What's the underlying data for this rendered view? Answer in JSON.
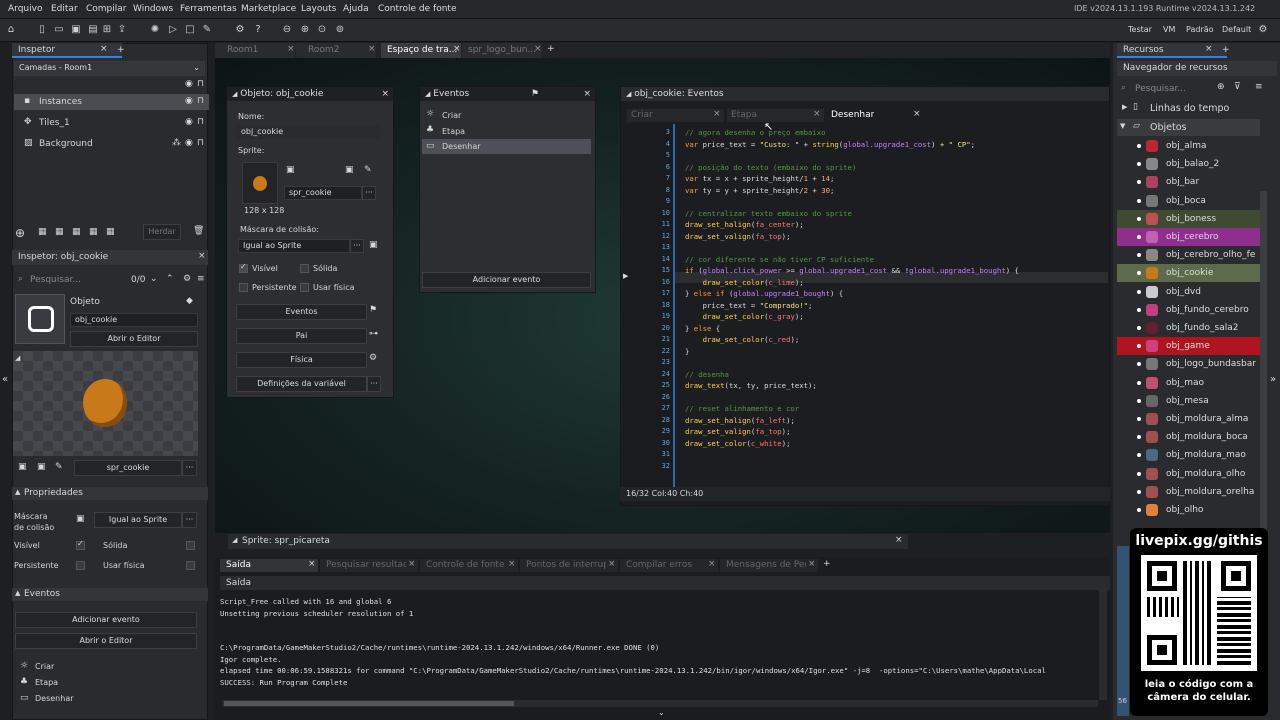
{
  "menu": [
    "Arquivo",
    "Editar",
    "Compilar",
    "Windows",
    "Ferramentas",
    "Marketplace",
    "Layouts",
    "Ajuda",
    "Controle de fonte"
  ],
  "ide_version": "IDE v2024.13.1.193  Runtime v2024.13.1.242",
  "target_bar": [
    "Testar",
    "VM",
    "Padrão",
    "Default"
  ],
  "top_tabs": [
    "Room1",
    "Room2",
    "Espaço de tra...",
    "spr_logo_bun..."
  ],
  "inspector": {
    "title": "Inspetor",
    "layers_dropdown": "Camadas - Room1",
    "layers": [
      "Instances",
      "Tiles_1",
      "Background"
    ],
    "herdar": "Herdar",
    "obj_title": "Inspetor: obj_cookie",
    "search_placeholder": "Pesquisar...",
    "count": "0/0",
    "objeto_label": "Objeto",
    "objeto_name": "obj_cookie",
    "open_editor": "Abrir o Editor",
    "sprite_name": "spr_cookie",
    "properties_header": "Propriedades",
    "mask_label": "Máscara de colisão",
    "mask_value": "Igual ao Sprite",
    "visible_label": "Visível",
    "solid_label": "Sólida",
    "persistent_label": "Persistente",
    "physics_label": "Usar física",
    "events_header": "Eventos",
    "add_event": "Adicionar evento",
    "open_editor2": "Abrir o Editor",
    "events": [
      "Criar",
      "Etapa",
      "Desenhar"
    ]
  },
  "object_window": {
    "title": "Objeto: obj_cookie",
    "name_label": "Nome:",
    "name_value": "obj_cookie",
    "sprite_label": "Sprite:",
    "sprite_value": "spr_cookie",
    "sprite_size": "128 x 128",
    "mask_label": "Máscara de colisão:",
    "mask_value": "Igual ao Sprite",
    "visible": "Visível",
    "solid": "Sólida",
    "persistent": "Persistente",
    "physics": "Usar física",
    "btn_events": "Eventos",
    "btn_parent": "Pai",
    "btn_physics": "Física",
    "btn_vars": "Definições da variável"
  },
  "events_window": {
    "title": "Eventos",
    "items": [
      "Criar",
      "Etapa",
      "Desenhar"
    ],
    "add_event": "Adicionar evento"
  },
  "code_window": {
    "title": "obj_cookie: Eventos",
    "tabs": [
      "Criar",
      "Etapa",
      "Desenhar"
    ],
    "status": "16/32 Col:40 Ch:40",
    "line_numbers": [
      "3",
      "4",
      "5",
      "6",
      "7",
      "8",
      "9",
      "10",
      "11",
      "12",
      "13",
      "14",
      "15",
      "16",
      "17",
      "18",
      "19",
      "20",
      "21",
      "22",
      "23",
      "24",
      "25",
      "26",
      "27",
      "28",
      "29",
      "30",
      "31",
      "32"
    ]
  },
  "sprite_panel_title": "Sprite: spr_picareta",
  "output": {
    "tabs": [
      "Saída",
      "Pesquisar resultados",
      "Controle de fonte",
      "Pontos de interrupç...",
      "Compilar erros",
      "Mensagens de Pena..."
    ],
    "header": "Saída",
    "lines": [
      "Script_Free called with 16 and global 6",
      "Unsetting previous scheduler resolution of 1",
      "",
      "",
      "C:\\ProgramData/GameMakerStudio2/Cache/runtimes\\runtime-2024.13.1.242/windows/x64/Runner.exe DONE (0)",
      "Igor complete.",
      "elapsed time 00:06:59.1588321s for command \"C:\\ProgramData/GameMakerStudio2/Cache/runtimes\\runtime-2024.13.1.242/bin/igor/windows/x64/Igor.exe\" -j=8  -options=\"C:\\Users\\mathe\\AppData\\Local",
      "SUCCESS: Run Program Complete"
    ]
  },
  "resources": {
    "title": "Recursos",
    "browser": "Navegador de recursos",
    "search_placeholder": "Pesquisar...",
    "groups": [
      "Linhas do tempo",
      "Objetos"
    ],
    "items": [
      "obj_alma",
      "obj_balao_2",
      "obj_bar",
      "obj_boca",
      "obj_boness",
      "obj_cerebro",
      "obj_cerebro_olho_fe",
      "obj_cookie",
      "obj_dvd",
      "obj_fundo_cerebro",
      "obj_fundo_sala2",
      "obj_game",
      "obj_logo_bundasbar",
      "obj_mao",
      "obj_mesa",
      "obj_moldura_alma",
      "obj_moldura_boca",
      "obj_moldura_mao",
      "obj_moldura_olho",
      "obj_moldura_orelha",
      "obj_olho"
    ],
    "highlight_colors": {
      "obj_boness": "#3f4a33",
      "obj_cerebro": "#8e2f8e",
      "obj_cookie": "#5f6a4c",
      "obj_game": "#b0151f"
    }
  },
  "overlay": {
    "url": "livepix.gg/githis",
    "caption_line1": "leia o código com a",
    "caption_line2": "câmera do celular."
  },
  "side_zoom": "56"
}
